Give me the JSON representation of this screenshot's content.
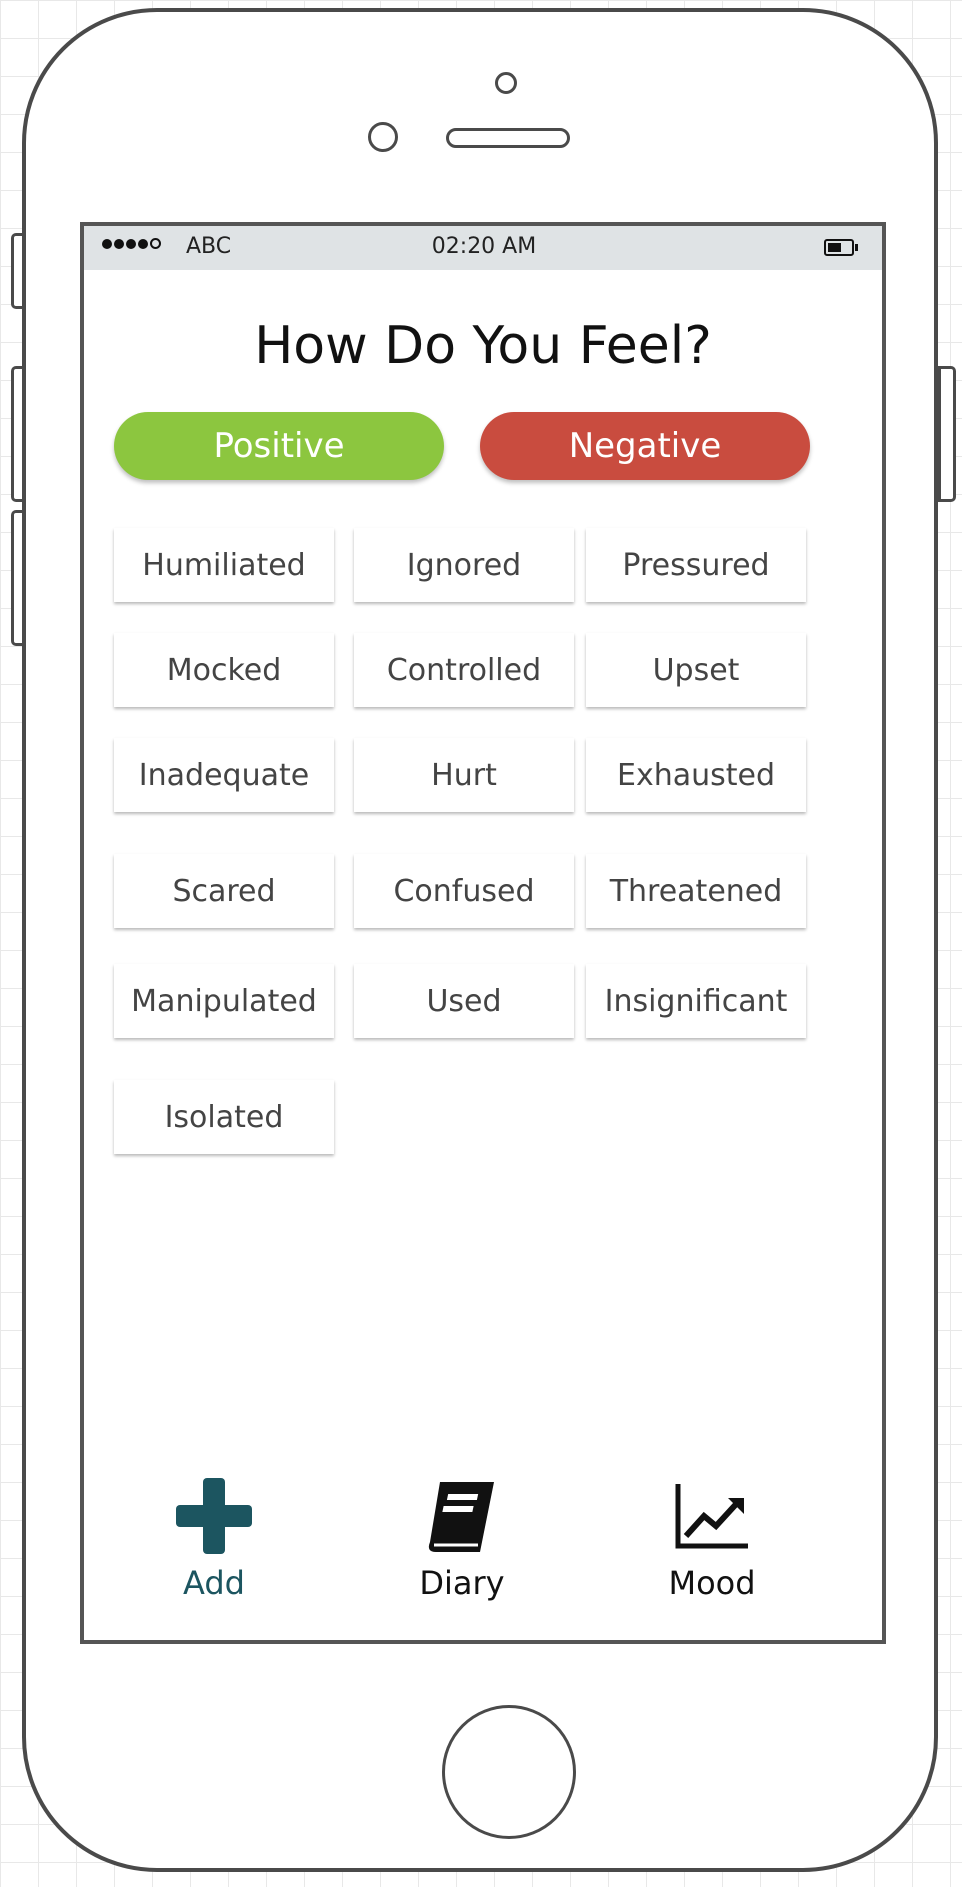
{
  "status_bar": {
    "carrier": "ABC",
    "time": "02:20 AM",
    "signal_bars_filled": 4,
    "signal_bars_total": 5,
    "battery_level_percent": 60
  },
  "page": {
    "title": "How Do You Feel?"
  },
  "toggle": {
    "positive_label": "Positive",
    "negative_label": "Negative",
    "positive_color": "#8cc63f",
    "negative_color": "#c94c3f"
  },
  "feelings": [
    "Humiliated",
    "Ignored",
    "Pressured",
    "Mocked",
    "Controlled",
    "Upset",
    "Inadequate",
    "Hurt",
    "Exhausted",
    "Scared",
    "Confused",
    "Threatened",
    "Manipulated",
    "Used",
    "Insignificant",
    "Isolated"
  ],
  "tabbar": {
    "add": {
      "label": "Add",
      "icon": "plus-icon",
      "color": "#1c5560"
    },
    "diary": {
      "label": "Diary",
      "icon": "book-icon"
    },
    "mood": {
      "label": "Mood",
      "icon": "line-chart-icon"
    }
  }
}
